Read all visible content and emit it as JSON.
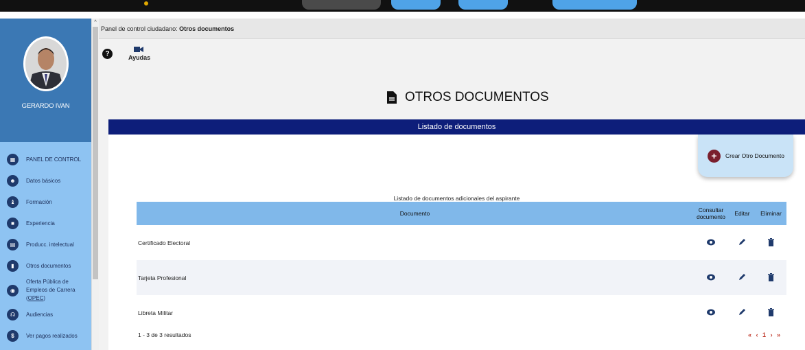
{
  "breadcrumb": {
    "prefix": "Panel de control ciudadano: ",
    "current": "Otros documentos"
  },
  "user": {
    "name": "GERARDO IVAN"
  },
  "sidebar": {
    "items": [
      {
        "label": "PANEL DE CONTROL",
        "icon": "dashboard-icon"
      },
      {
        "label": "Datos básicos",
        "icon": "people-icon"
      },
      {
        "label": "Formación",
        "icon": "graduation-icon"
      },
      {
        "label": "Experiencia",
        "icon": "briefcase-icon"
      },
      {
        "label": "Producc. intelectual",
        "icon": "book-icon"
      },
      {
        "label": "Otros documentos",
        "icon": "document-icon"
      },
      {
        "label_line1": "Oferta Pública de",
        "label_line2": "Empleos de Carrera (",
        "label_link": "OPEC",
        "label_end": ")",
        "icon": "globe-icon"
      },
      {
        "label": "Audiencias",
        "icon": "audience-icon"
      },
      {
        "label": "Ver pagos realizados",
        "icon": "dollar-icon"
      }
    ]
  },
  "toolbar": {
    "help_icon": "help-icon",
    "ayudas_label": "Ayudas",
    "ayudas_icon": "video-camera-icon"
  },
  "page": {
    "title": "OTROS DOCUMENTOS"
  },
  "panel": {
    "header": "Listado de documentos",
    "create_button": "Crear Otro Documento",
    "caption": "Listado de documentos adicionales del aspirante"
  },
  "table": {
    "columns": [
      "Documento",
      "Consultar documento",
      "Editar",
      "Eliminar"
    ],
    "rows": [
      {
        "name": "Certificado Electoral"
      },
      {
        "name": "Tarjeta Profesional"
      },
      {
        "name": "Libreta Militar"
      }
    ]
  },
  "footer": {
    "results": "1 - 3 de 3 resultados",
    "current_page": "1"
  },
  "colors": {
    "panel_header": "#0d1e7a",
    "sidebar": "#8ec3f2",
    "profile": "#3b78b4",
    "table_header": "#80b8ea",
    "pager": "#c0392b"
  }
}
